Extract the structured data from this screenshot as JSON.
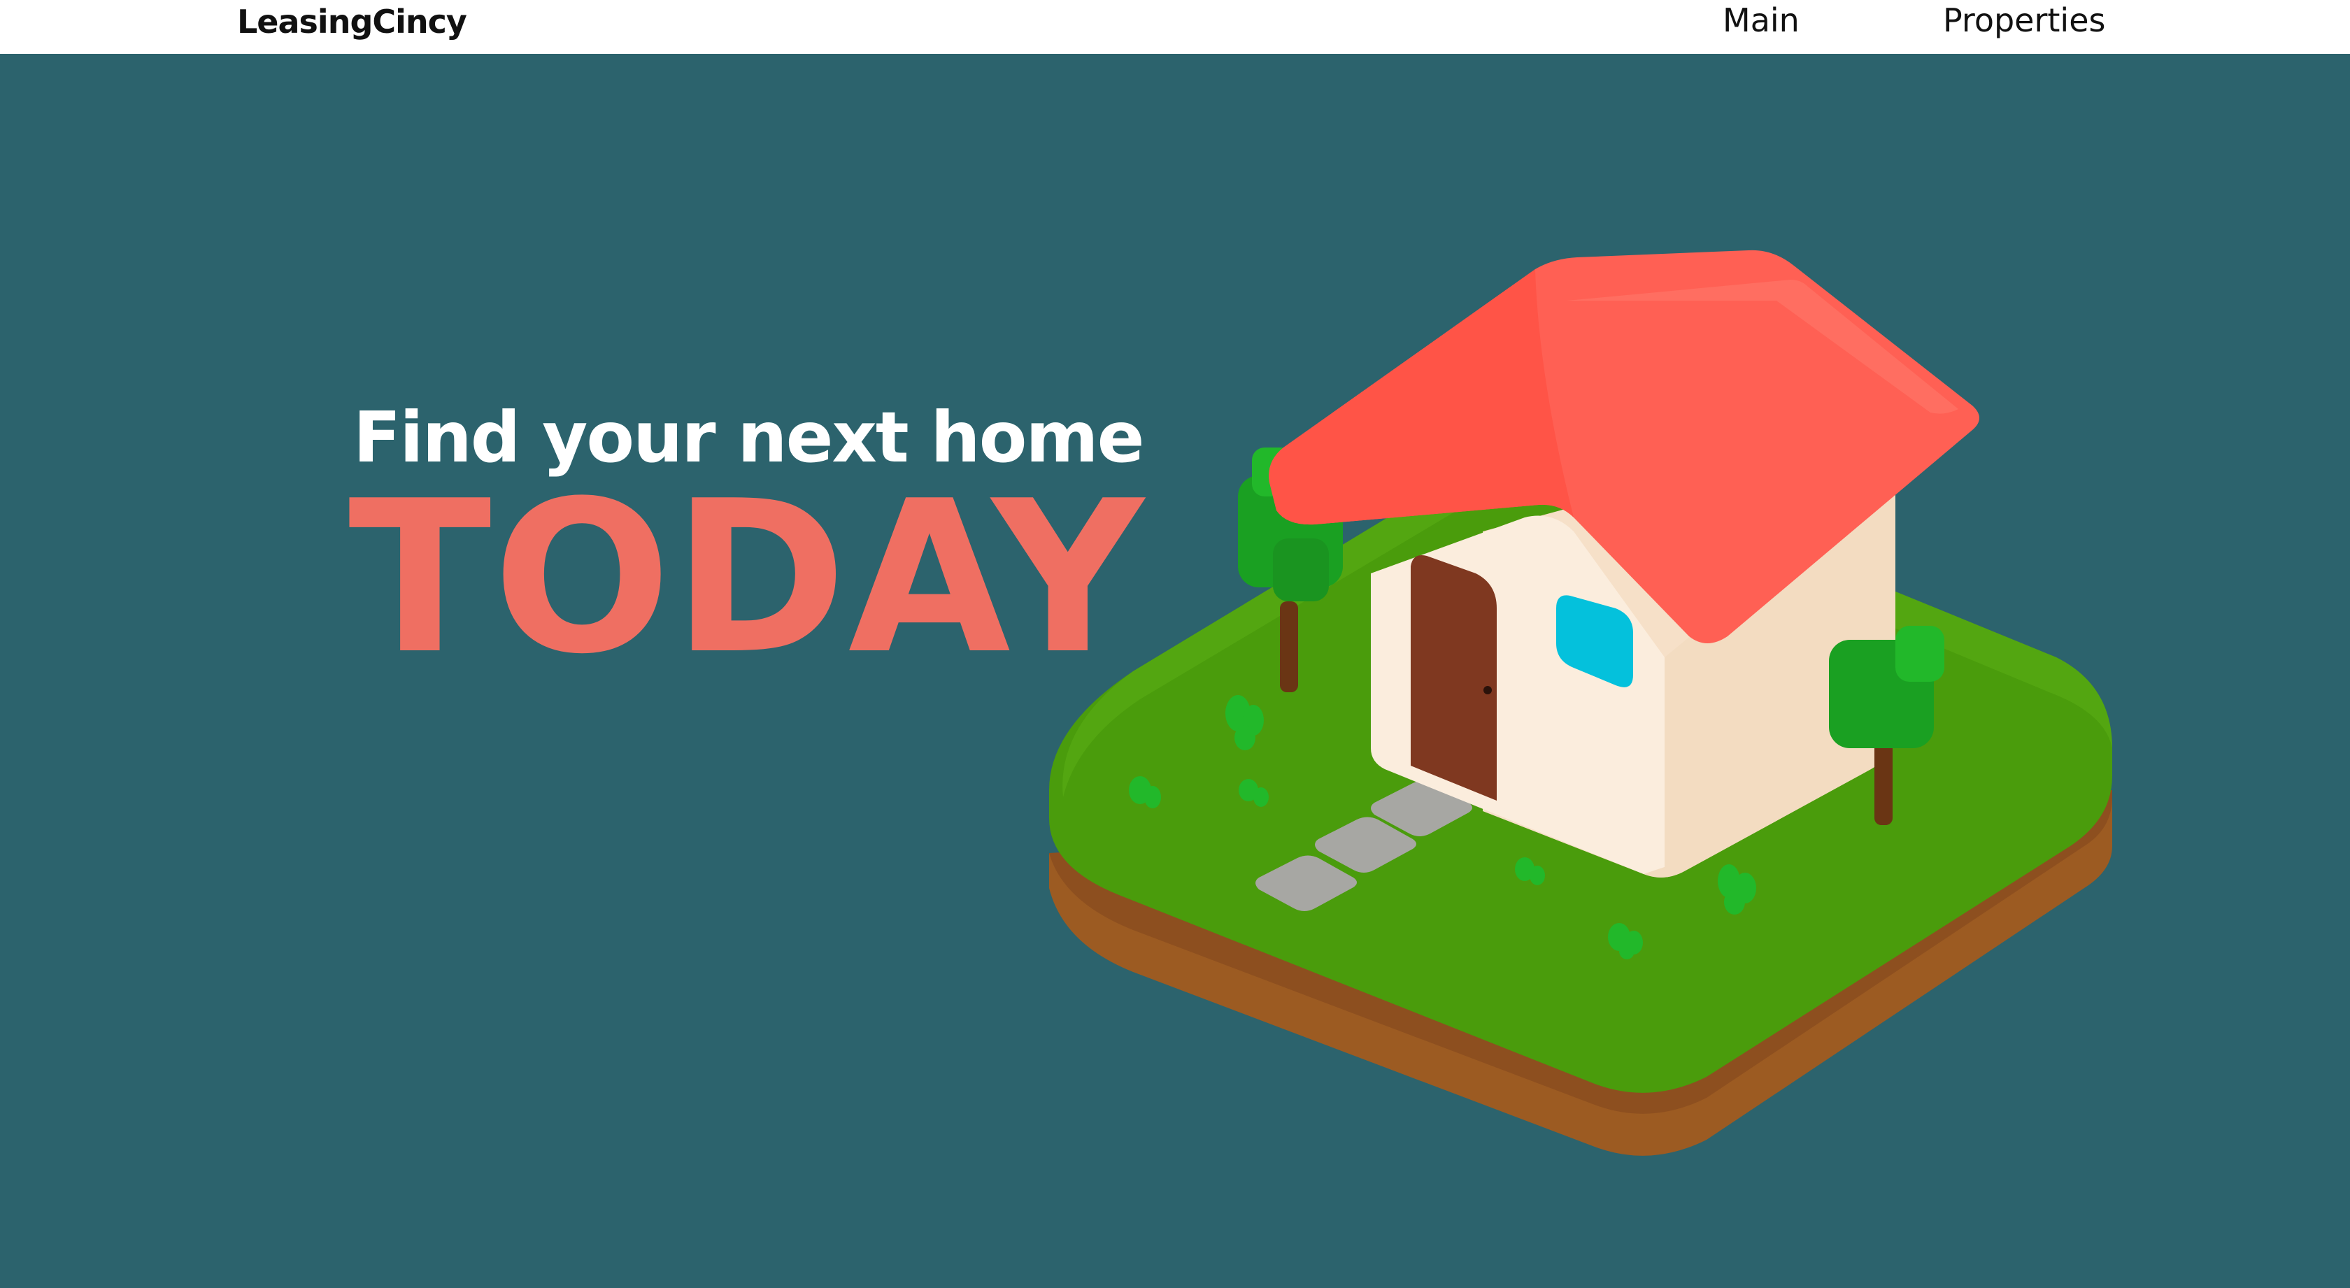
{
  "nav": {
    "brand": "LeasingCincy",
    "links": [
      {
        "label": "Main"
      },
      {
        "label": "Properties"
      }
    ]
  },
  "hero": {
    "headline": "Find your next home",
    "accent": "TODAY",
    "illustration_icon": "house-illustration-icon"
  },
  "colors": {
    "hero_bg": "#2c636d",
    "accent": "#ef6f62",
    "headline": "#ffffff",
    "nav_bg": "#ffffff"
  }
}
